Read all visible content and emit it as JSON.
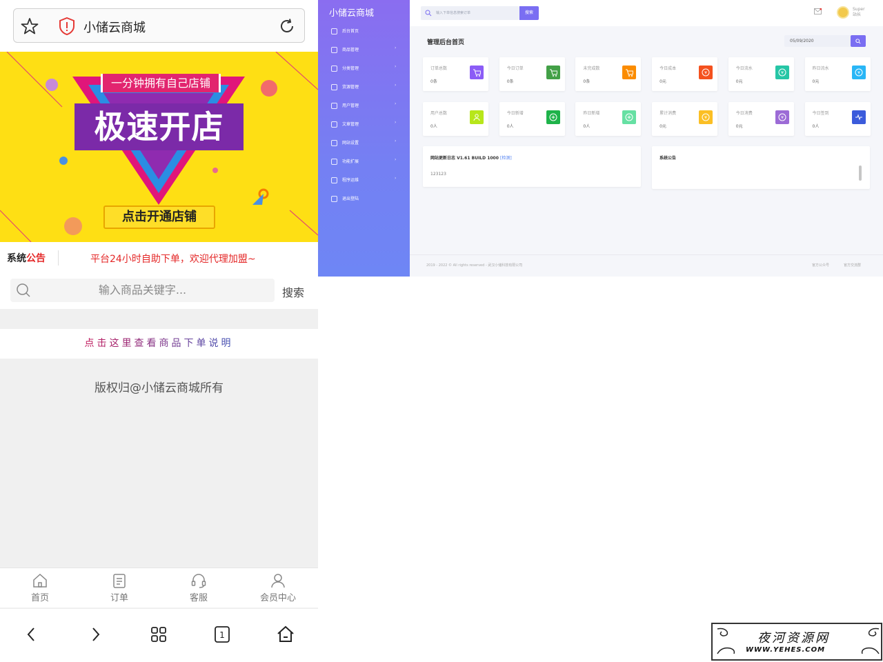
{
  "browser": {
    "site_name": "小储云商城"
  },
  "banner": {
    "tag": "一分钟拥有自己店铺",
    "headline": "极速开店",
    "cta": "点击开通店铺"
  },
  "notice": {
    "label_a": "系统",
    "label_b": "公告",
    "message": "平台24小时自助下单，欢迎代理加盟~"
  },
  "search": {
    "placeholder": "输入商品关键字...",
    "button": "搜索"
  },
  "order_help": "点击这里查看商品下单说明",
  "copyright": "版权归@小储云商城所有",
  "tabbar": [
    {
      "label": "首页",
      "icon": "home-icon"
    },
    {
      "label": "订单",
      "icon": "clipboard-icon"
    },
    {
      "label": "客服",
      "icon": "headset-icon"
    },
    {
      "label": "会员中心",
      "icon": "user-icon"
    }
  ],
  "browser_nav": {
    "tab_count": "1"
  },
  "admin": {
    "brand": "小储云商城",
    "menu": [
      {
        "label": "后台首页",
        "has_arrow": false
      },
      {
        "label": "商品管理",
        "has_arrow": true
      },
      {
        "label": "分类管理",
        "has_arrow": true
      },
      {
        "label": "货源管理",
        "has_arrow": true
      },
      {
        "label": "用户管理",
        "has_arrow": true
      },
      {
        "label": "文章管理",
        "has_arrow": true
      },
      {
        "label": "网站设置",
        "has_arrow": true
      },
      {
        "label": "功能扩展",
        "has_arrow": true
      },
      {
        "label": "程序运维",
        "has_arrow": true
      },
      {
        "label": "退出登陆",
        "has_arrow": false
      }
    ],
    "search_placeholder": "输入下单信息搜索订单",
    "search_button": "搜索",
    "user": {
      "name": "Super",
      "role": "站长"
    },
    "page_title": "管理后台首页",
    "date": "05/09/2020",
    "stats_row1": [
      {
        "label": "订单总数",
        "value": "0条",
        "color": "#8b5cf6"
      },
      {
        "label": "今日订单",
        "value": "0条",
        "color": "#43a047"
      },
      {
        "label": "未完成数",
        "value": "0条",
        "color": "#fb8c00"
      },
      {
        "label": "今日成本",
        "value": "0元",
        "color": "#f4511e"
      },
      {
        "label": "今日流水",
        "value": "0元",
        "color": "#26c6a6"
      },
      {
        "label": "昨日流水",
        "value": "0元",
        "color": "#29b6f6"
      }
    ],
    "stats_row2": [
      {
        "label": "用户总数",
        "value": "0人",
        "color": "#b7e61a"
      },
      {
        "label": "今日新增",
        "value": "0人",
        "color": "#1eb34a"
      },
      {
        "label": "昨日新增",
        "value": "0人",
        "color": "#66e0a3"
      },
      {
        "label": "累计消费",
        "value": "0元",
        "color": "#fbbf24"
      },
      {
        "label": "今日消费",
        "value": "0元",
        "color": "#9c6bd6"
      },
      {
        "label": "今日签到",
        "value": "0人",
        "color": "#3b5bdb"
      }
    ],
    "log_panel": {
      "title": "网站更新日志 V1.61 BUILD 1000",
      "check": "[检测]",
      "body": "123123"
    },
    "announce_panel": {
      "title": "系统公告"
    },
    "footer": {
      "copyright": "2019 - 2022 © All rights reserved - 武汉小储科技有限公司",
      "link1": "官方公众号",
      "link2": "官方交流群"
    }
  },
  "watermark": {
    "title": "夜河资源网",
    "url": "WWW.YEHES.COM"
  }
}
